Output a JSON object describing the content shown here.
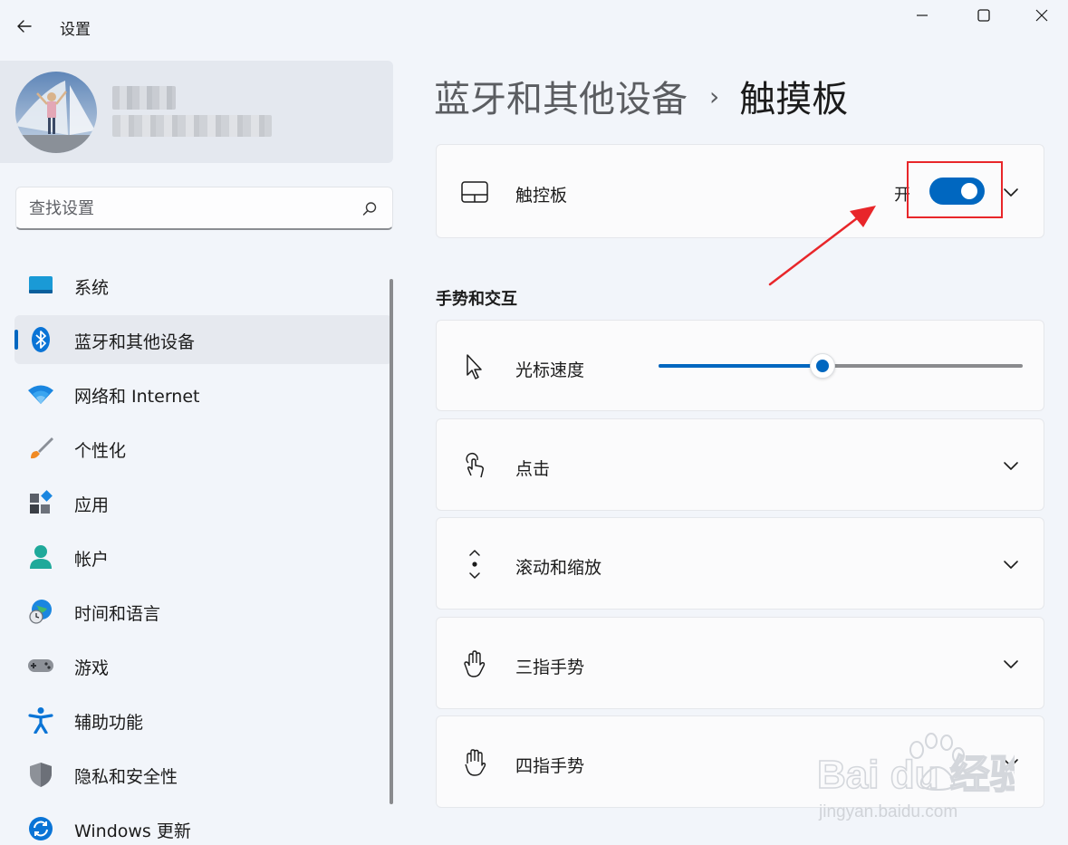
{
  "window": {
    "title": "设置"
  },
  "profile": {
    "name": "张",
    "email": "………"
  },
  "search": {
    "placeholder": "查找设置"
  },
  "sidebar": {
    "items": [
      {
        "label": "系统",
        "icon": "system-icon"
      },
      {
        "label": "蓝牙和其他设备",
        "icon": "bluetooth-icon",
        "selected": true
      },
      {
        "label": "网络和 Internet",
        "icon": "wifi-icon"
      },
      {
        "label": "个性化",
        "icon": "brush-icon"
      },
      {
        "label": "应用",
        "icon": "apps-icon"
      },
      {
        "label": "帐户",
        "icon": "account-icon"
      },
      {
        "label": "时间和语言",
        "icon": "globe-clock-icon"
      },
      {
        "label": "游戏",
        "icon": "gamepad-icon"
      },
      {
        "label": "辅助功能",
        "icon": "accessibility-icon"
      },
      {
        "label": "隐私和安全性",
        "icon": "shield-icon"
      },
      {
        "label": "Windows 更新",
        "icon": "update-icon"
      }
    ]
  },
  "breadcrumb": {
    "parent": "蓝牙和其他设备",
    "separator": "›",
    "current": "触摸板"
  },
  "touchpad": {
    "label": "触控板",
    "state_label": "开",
    "enabled": true
  },
  "gestures": {
    "section_title": "手势和交互",
    "cursor_speed": {
      "label": "光标速度",
      "value": 0.45
    },
    "items": [
      {
        "label": "点击",
        "icon": "tap-icon"
      },
      {
        "label": "滚动和缩放",
        "icon": "scroll-icon"
      },
      {
        "label": "三指手势",
        "icon": "three-finger-hand-icon"
      },
      {
        "label": "四指手势",
        "icon": "four-finger-hand-icon"
      }
    ]
  },
  "watermark": {
    "brand": "Bai du 经验",
    "url": "jingyan.baidu.com"
  },
  "colors": {
    "accent": "#0067c0",
    "annotation_red": "#e8262a",
    "background": "#f2f5fa"
  }
}
